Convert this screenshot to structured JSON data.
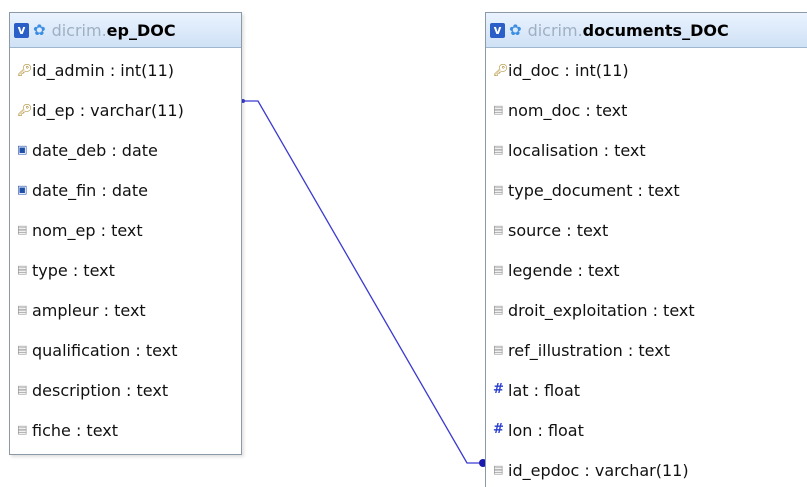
{
  "tables": {
    "ep_doc": {
      "db": "dicrim.",
      "name": "ep_DOC",
      "columns": [
        {
          "label": "id_admin : int(11)",
          "icon": "key-icon"
        },
        {
          "label": "id_ep : varchar(11)",
          "icon": "key-icon"
        },
        {
          "label": "date_deb : date",
          "icon": "date-icon"
        },
        {
          "label": "date_fin : date",
          "icon": "date-icon"
        },
        {
          "label": "nom_ep : text",
          "icon": "text-icon"
        },
        {
          "label": "type : text",
          "icon": "text-icon"
        },
        {
          "label": "ampleur : text",
          "icon": "text-icon"
        },
        {
          "label": "qualification : text",
          "icon": "text-icon"
        },
        {
          "label": "description : text",
          "icon": "text-icon"
        },
        {
          "label": "fiche : text",
          "icon": "text-icon"
        }
      ]
    },
    "documents_doc": {
      "db": "dicrim.",
      "name": "documents_DOC",
      "columns": [
        {
          "label": "id_doc : int(11)",
          "icon": "key-icon"
        },
        {
          "label": "nom_doc : text",
          "icon": "text-icon"
        },
        {
          "label": "localisation : text",
          "icon": "text-icon"
        },
        {
          "label": "type_document : text",
          "icon": "text-icon"
        },
        {
          "label": "source : text",
          "icon": "text-icon"
        },
        {
          "label": "legende : text",
          "icon": "text-icon"
        },
        {
          "label": "droit_exploitation : text",
          "icon": "text-icon"
        },
        {
          "label": "ref_illustration : text",
          "icon": "text-icon"
        },
        {
          "label": "lat : float",
          "icon": "number-icon"
        },
        {
          "label": "lon : float",
          "icon": "number-icon"
        },
        {
          "label": "id_epdoc : varchar(11)",
          "icon": "text-icon"
        }
      ]
    }
  },
  "header": {
    "toggle_label": "v"
  },
  "colors": {
    "relation_line": "#3a3ad0",
    "header_gradient_top": "#eaf3ff",
    "header_gradient_bottom": "#cfe1f5",
    "db_prefix": "#9fb0c4"
  }
}
